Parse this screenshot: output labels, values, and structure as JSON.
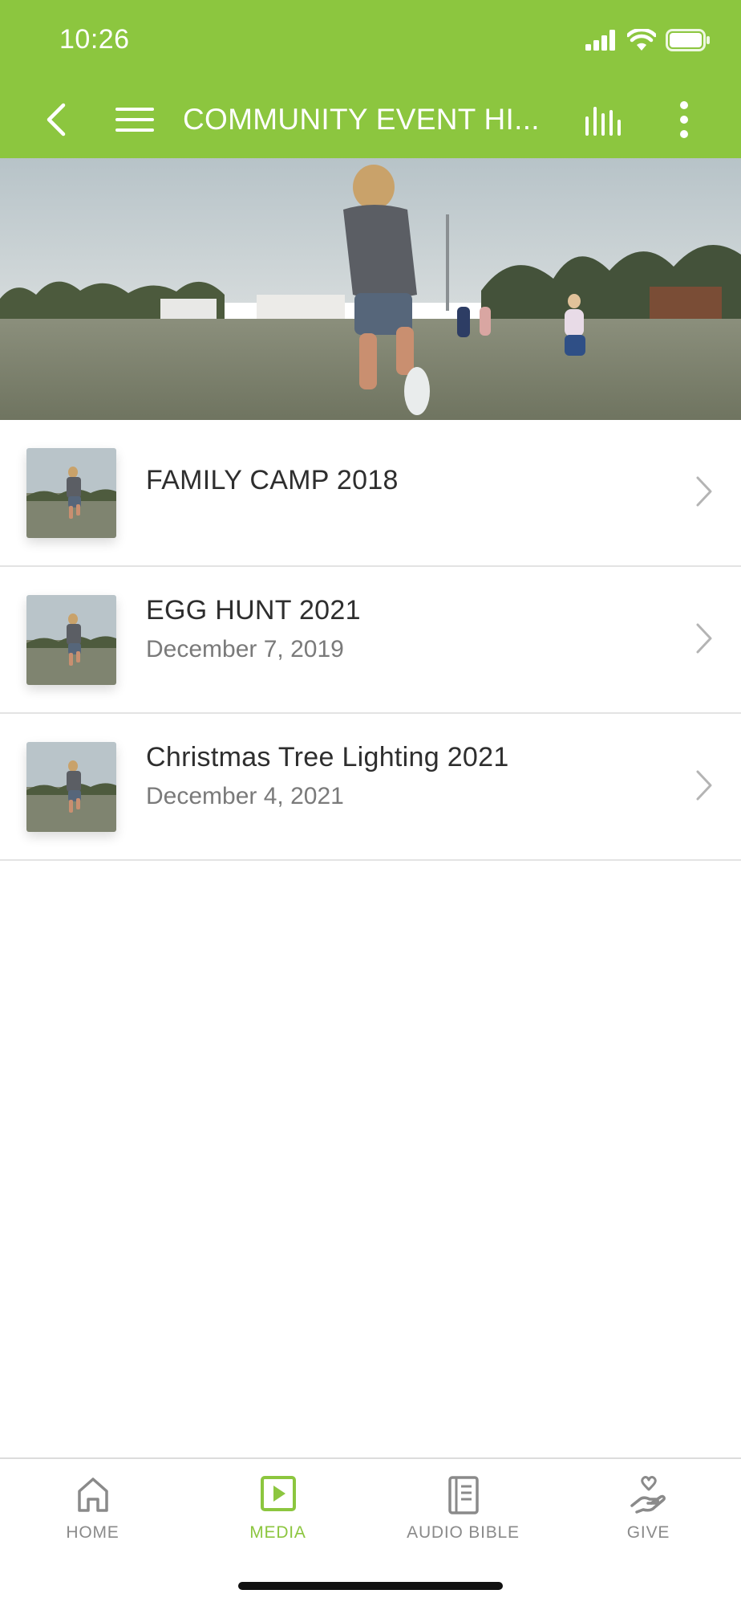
{
  "status_bar": {
    "time": "10:26"
  },
  "header": {
    "title": "COMMUNITY EVENT HI...",
    "back_icon": "chevron-left-icon",
    "menu_icon": "hamburger-icon",
    "audio_icon": "audio-bars-icon",
    "more_icon": "more-vertical-icon"
  },
  "list": {
    "items": [
      {
        "title": "FAMILY CAMP 2018",
        "date": ""
      },
      {
        "title": "EGG HUNT 2021",
        "date": "December 7, 2019"
      },
      {
        "title": "Christmas Tree Lighting 2021",
        "date": "December 4, 2021"
      }
    ]
  },
  "tabs": [
    {
      "label": "HOME",
      "icon": "home-icon",
      "active": false
    },
    {
      "label": "MEDIA",
      "icon": "media-play-icon",
      "active": true
    },
    {
      "label": "AUDIO BIBLE",
      "icon": "book-icon",
      "active": false
    },
    {
      "label": "GIVE",
      "icon": "give-hand-heart-icon",
      "active": false
    }
  ],
  "colors": {
    "accent": "#8cc63f",
    "text": "#2e2e2e",
    "muted": "#7a7a7a",
    "divider": "#e3e3e3"
  }
}
